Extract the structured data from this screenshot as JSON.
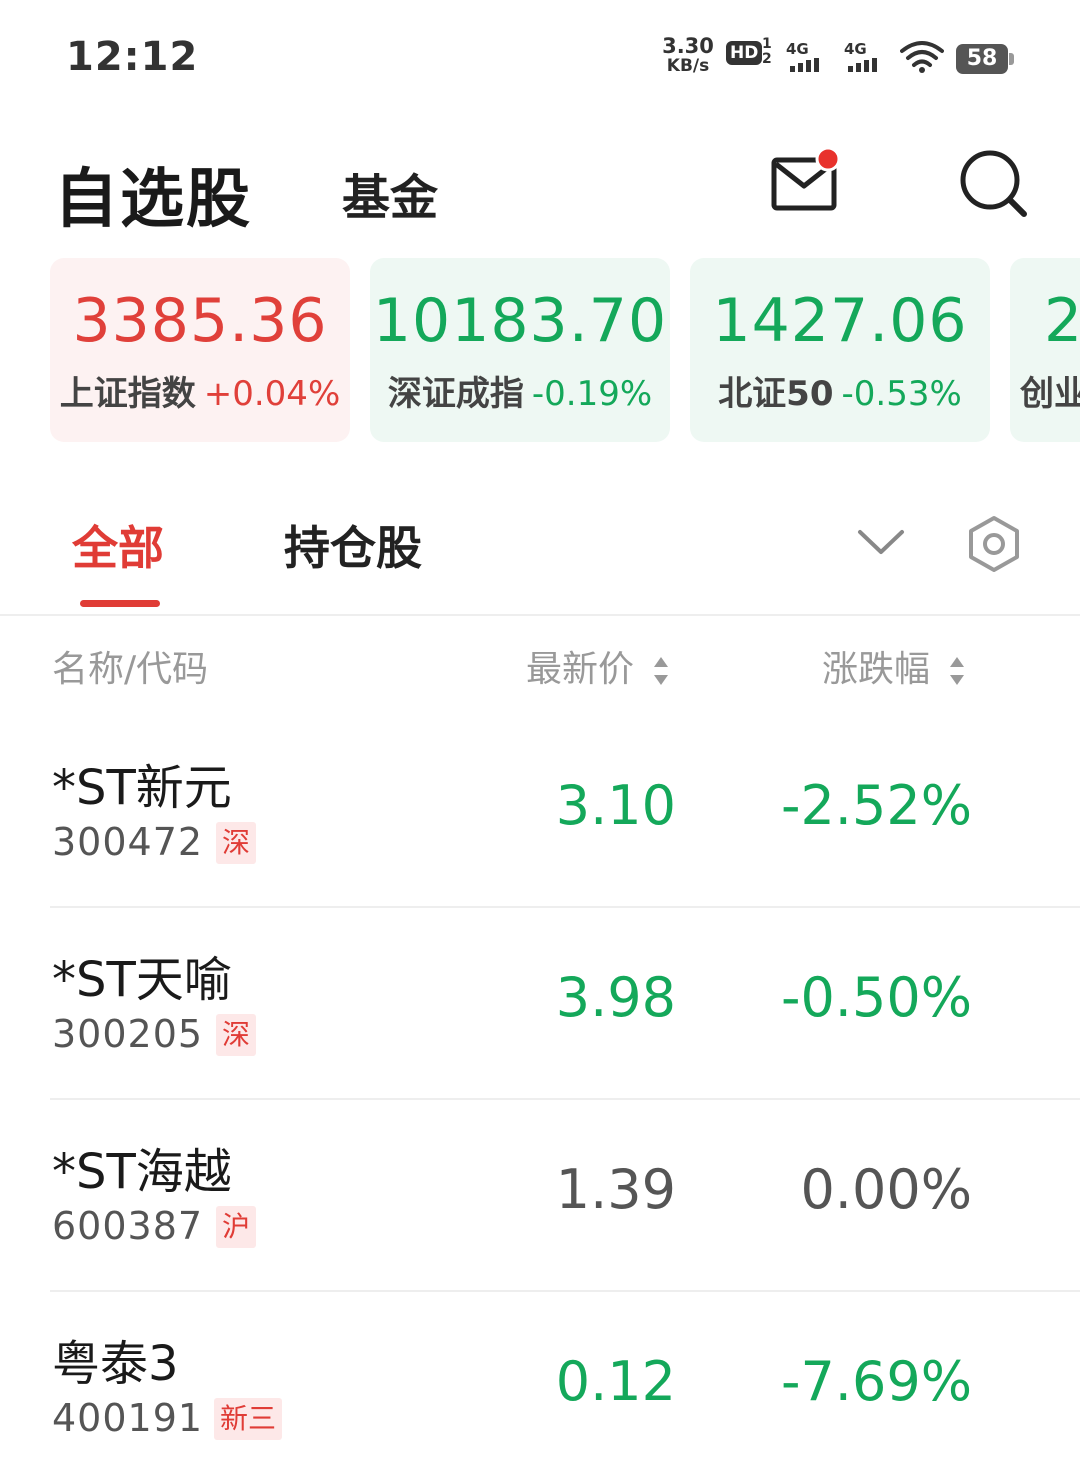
{
  "status_bar": {
    "time": "12:12",
    "net_speed_value": "3.30",
    "net_speed_unit": "KB/s",
    "hd_label": "HD",
    "hd_sims": "1\n2",
    "sig1_label": "4G",
    "sig2_label": "4G",
    "battery": "58"
  },
  "header": {
    "title": "自选股",
    "fund_tab": "基金"
  },
  "indices": [
    {
      "value": "3385.36",
      "name": "上证指数",
      "change": "+0.04%",
      "trend": "up"
    },
    {
      "value": "10183.70",
      "name": "深证成指",
      "change": "-0.19%",
      "trend": "down"
    },
    {
      "value": "1427.06",
      "name": "北证50",
      "change": "-0.53%",
      "trend": "down"
    },
    {
      "value": "2",
      "name": "创业",
      "change": "",
      "trend": "down"
    }
  ],
  "sub_tabs": {
    "all": "全部",
    "holdings": "持仓股"
  },
  "columns": {
    "name_code": "名称/代码",
    "latest_price": "最新价",
    "change_pct": "涨跌幅"
  },
  "stocks": [
    {
      "name": "*ST新元",
      "code": "300472",
      "market": "深",
      "price": "3.10",
      "change": "-2.52%",
      "trend": "down"
    },
    {
      "name": "*ST天喻",
      "code": "300205",
      "market": "深",
      "price": "3.98",
      "change": "-0.50%",
      "trend": "down"
    },
    {
      "name": "*ST海越",
      "code": "600387",
      "market": "沪",
      "price": "1.39",
      "change": "0.00%",
      "trend": "flat"
    },
    {
      "name": "粤泰3",
      "code": "400191",
      "market": "新三",
      "price": "0.12",
      "change": "-7.69%",
      "trend": "down"
    }
  ],
  "colors": {
    "up": "#e0403a",
    "down": "#14a85a",
    "flat": "#555555",
    "accent": "#e03c36"
  }
}
